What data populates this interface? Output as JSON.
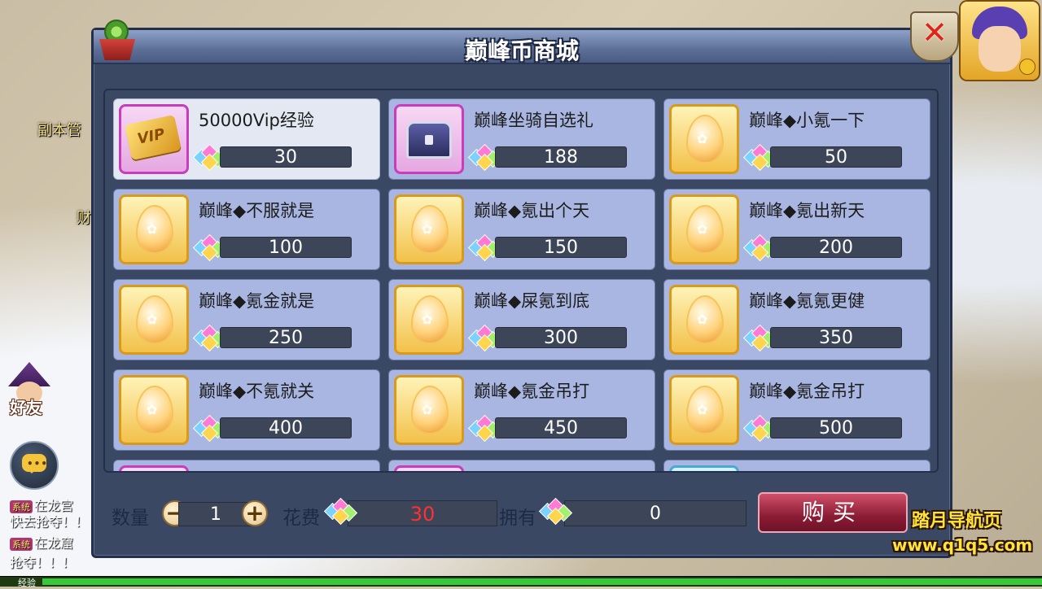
{
  "background": {
    "npc_labels": [
      "副本管",
      "财"
    ],
    "friend_label": "好友",
    "system_messages": [
      {
        "tag": "系统",
        "text": "在龙宫"
      },
      {
        "text": "快去抢夺！！"
      },
      {
        "tag": "系统",
        "text": "在龙窟"
      },
      {
        "text": "抢夺！！！"
      }
    ],
    "exp_label": "经验"
  },
  "shop": {
    "title": "巅峰币商城",
    "close_icon": "close-x-icon",
    "items": [
      {
        "name": "50000Vip经验",
        "price": "30",
        "icon": "vip-card-icon",
        "frame": "purple",
        "selected": true
      },
      {
        "name": "巅峰坐骑自选礼",
        "price": "188",
        "icon": "treasure-chest-icon",
        "frame": "purple",
        "selected": false
      },
      {
        "name": "巅峰◆小氪一下",
        "price": "50",
        "icon": "golden-egg-icon",
        "frame": "gold",
        "selected": false
      },
      {
        "name": "巅峰◆不服就是",
        "price": "100",
        "icon": "golden-egg-icon",
        "frame": "gold",
        "selected": false
      },
      {
        "name": "巅峰◆氪出个天",
        "price": "150",
        "icon": "golden-egg-icon",
        "frame": "gold",
        "selected": false
      },
      {
        "name": "巅峰◆氪出新天",
        "price": "200",
        "icon": "golden-egg-icon",
        "frame": "gold",
        "selected": false
      },
      {
        "name": "巅峰◆氪金就是",
        "price": "250",
        "icon": "golden-egg-icon",
        "frame": "gold",
        "selected": false
      },
      {
        "name": "巅峰◆屎氪到底",
        "price": "300",
        "icon": "golden-egg-icon",
        "frame": "gold",
        "selected": false
      },
      {
        "name": "巅峰◆氪氪更健",
        "price": "350",
        "icon": "golden-egg-icon",
        "frame": "gold",
        "selected": false
      },
      {
        "name": "巅峰◆不氪就关",
        "price": "400",
        "icon": "golden-egg-icon",
        "frame": "gold",
        "selected": false
      },
      {
        "name": "巅峰◆氪金吊打",
        "price": "450",
        "icon": "golden-egg-icon",
        "frame": "gold",
        "selected": false
      },
      {
        "name": "巅峰◆氪金吊打",
        "price": "500",
        "icon": "golden-egg-icon",
        "frame": "gold",
        "selected": false
      }
    ],
    "partial_items": [
      {
        "name": "",
        "frame": "purple"
      },
      {
        "name": "",
        "frame": "purple"
      },
      {
        "name": "",
        "frame": "blue"
      }
    ],
    "currency_icon": "rainbow-gem-icon",
    "quantity_label": "数量",
    "quantity_value": "1",
    "minus_symbol": "−",
    "plus_symbol": "+",
    "cost_label": "花费",
    "cost_value": "30",
    "owned_label": "拥有",
    "owned_value": "0",
    "buy_label": "购买"
  },
  "watermark": {
    "line1": "踏月导航页",
    "line2": "www.q1q5.com"
  },
  "colors": {
    "panel_bg": "#3b4864",
    "card_bg": "#a8b6e1",
    "selected_card_bg": "#e3e8f3",
    "cost_text": "#ff3030",
    "buy_button": "#8c1c35"
  }
}
